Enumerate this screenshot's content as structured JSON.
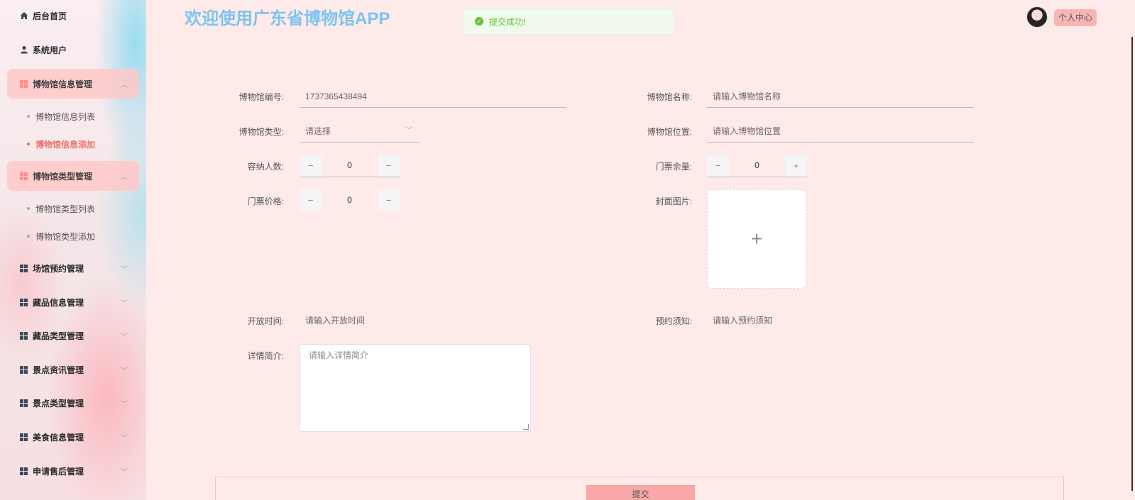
{
  "sidebar": {
    "items": [
      {
        "label": "后台首页"
      },
      {
        "label": "系统用户"
      },
      {
        "label": "博物馆信息管理"
      },
      {
        "label": "博物馆类型管理"
      },
      {
        "label": "场馆预约管理"
      },
      {
        "label": "藏品信息管理"
      },
      {
        "label": "藏品类型管理"
      },
      {
        "label": "景点资讯管理"
      },
      {
        "label": "景点类型管理"
      },
      {
        "label": "美食信息管理"
      },
      {
        "label": "申请售后管理"
      }
    ],
    "sub_museum_info": [
      {
        "label": "博物馆信息列表"
      },
      {
        "label": "博物馆信息添加"
      }
    ],
    "sub_museum_type": [
      {
        "label": "博物馆类型列表"
      },
      {
        "label": "博物馆类型添加"
      }
    ]
  },
  "header": {
    "title": "欢迎使用广东省博物馆APP",
    "user_center": "个人中心"
  },
  "toast": {
    "message": "提交成功!"
  },
  "form": {
    "museum_no_label": "博物馆编号:",
    "museum_no_value": "1737365438494",
    "museum_name_label": "博物馆名称:",
    "museum_name_placeholder": "请输入博物馆名称",
    "museum_type_label": "博物馆类型:",
    "museum_type_placeholder": "请选择",
    "museum_location_label": "博物馆位置:",
    "museum_location_placeholder": "请输入博物馆位置",
    "capacity_label": "容纳人数:",
    "capacity_value": "0",
    "tickets_left_label": "门票余量:",
    "tickets_left_value": "0",
    "ticket_price_label": "门票价格:",
    "ticket_price_value": "0",
    "cover_label": "封面图片:",
    "open_time_label": "开放时间:",
    "open_time_placeholder": "请输入开放时间",
    "booking_notice_label": "预约须知:",
    "booking_notice_placeholder": "请输入预约须知",
    "detail_label": "详情简介:",
    "detail_placeholder": "请输入详情简介",
    "submit_label": "提交"
  },
  "colors": {
    "background": "#ffeaea",
    "title": "#7cc4f0",
    "accent": "#f8a8a8",
    "active_menu": "#f07070",
    "success": "#67c23a"
  }
}
